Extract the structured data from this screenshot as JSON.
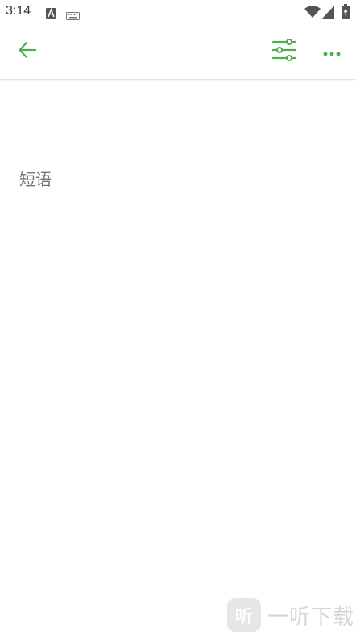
{
  "status_bar": {
    "time": "3:14",
    "icons": [
      "a-badge-icon",
      "keyboard-icon",
      "wifi-icon",
      "signal-icon",
      "battery-charging-icon"
    ]
  },
  "toolbar": {
    "back_icon": "arrow-left-icon",
    "filter_icon": "sliders-icon",
    "more_icon": "more-horizontal-icon",
    "accent_color": "#4caf50"
  },
  "editor": {
    "placeholder": "短语",
    "value": ""
  },
  "watermark": {
    "logo_text": "听",
    "text": "一听下载"
  }
}
